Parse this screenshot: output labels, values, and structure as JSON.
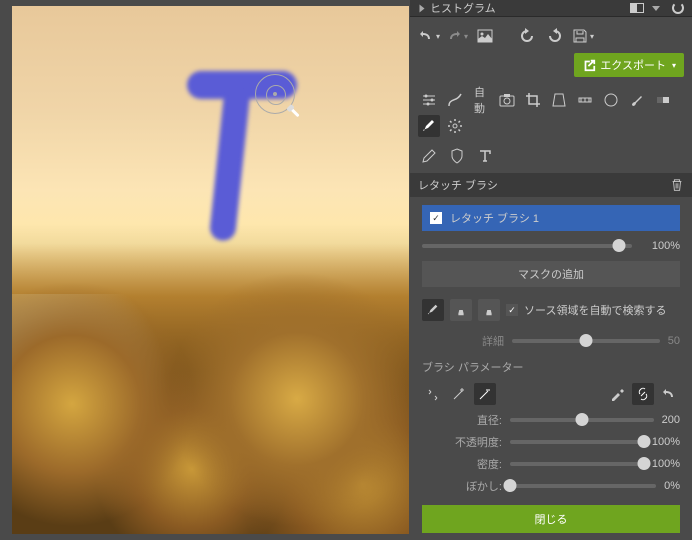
{
  "header": {
    "title": "ヒストグラム"
  },
  "toolbar": {
    "auto_label": "自動",
    "export_label": "エクスポート"
  },
  "section": {
    "title": "レタッチ ブラシ"
  },
  "brush": {
    "name": "レタッチ ブラシ 1",
    "opacity_pct": "100%"
  },
  "mask": {
    "add_label": "マスクの追加"
  },
  "source": {
    "auto_label": "ソース領域を自動で検索する"
  },
  "detail": {
    "label": "詳細",
    "value": "50"
  },
  "params": {
    "header": "ブラシ パラメーター",
    "diameter": {
      "label": "直径:",
      "value": "200",
      "pct": 50
    },
    "opacity": {
      "label": "不透明度:",
      "value": "100%",
      "pct": 100
    },
    "density": {
      "label": "密度:",
      "value": "100%",
      "pct": 100
    },
    "blur": {
      "label": "ぼかし:",
      "value": "0%",
      "pct": 0
    }
  },
  "close": {
    "label": "閉じる"
  }
}
